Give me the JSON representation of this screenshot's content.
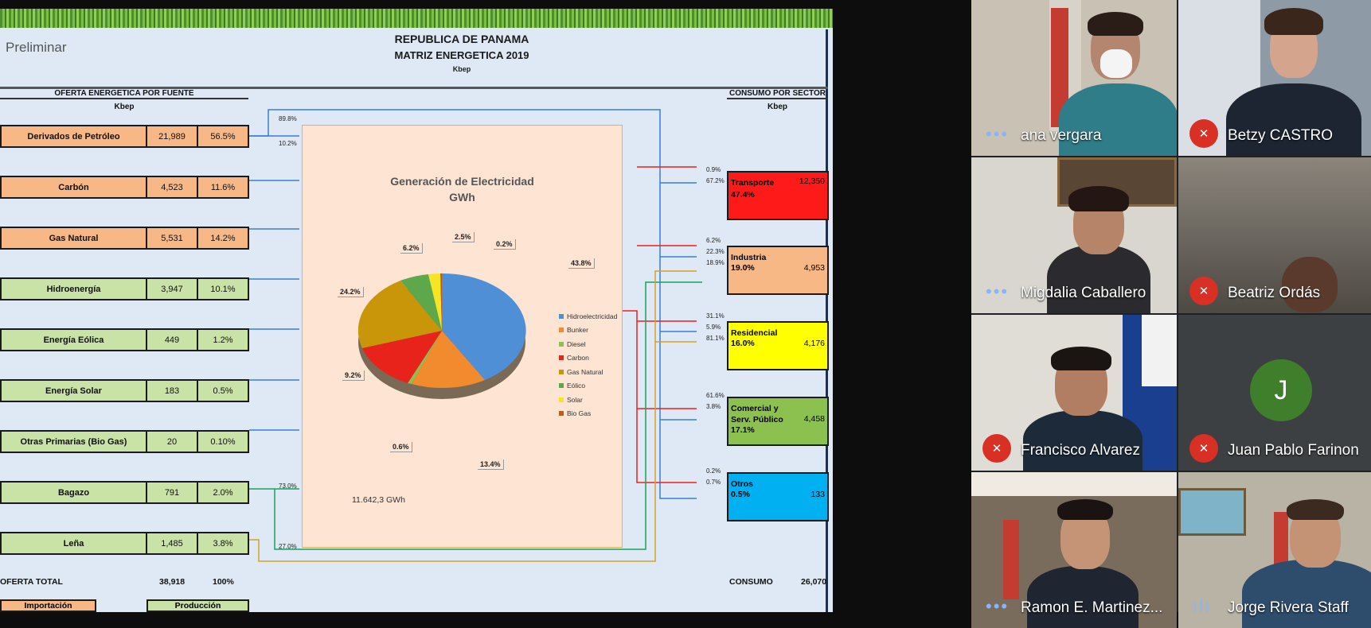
{
  "slide": {
    "status": "Preliminar",
    "title": "REPUBLICA DE PANAMA",
    "subtitle": "MATRIZ ENERGETICA  2019",
    "unit": "Kbep",
    "left_header": "OFERTA ENERGETICA POR FUENTE",
    "left_unit": "Kbep",
    "right_header": "CONSUMO POR SECTOR",
    "right_unit": "Kbep",
    "sources": [
      {
        "name": "Derivados de Petróleo",
        "value": "21,989",
        "pct": "56.5%",
        "group": "orange"
      },
      {
        "name": "Carbón",
        "value": "4,523",
        "pct": "11.6%",
        "group": "orange"
      },
      {
        "name": "Gas Natural",
        "value": "5,531",
        "pct": "14.2%",
        "group": "orange"
      },
      {
        "name": "Hidroenergía",
        "value": "3,947",
        "pct": "10.1%",
        "group": "green"
      },
      {
        "name": "Energía Eólica",
        "value": "449",
        "pct": "1.2%",
        "group": "green"
      },
      {
        "name": "Energía Solar",
        "value": "183",
        "pct": "0.5%",
        "group": "green"
      },
      {
        "name": "Otras Primarias (Bio Gas)",
        "value": "20",
        "pct": "0.10%",
        "group": "green"
      },
      {
        "name": "Bagazo",
        "value": "791",
        "pct": "2.0%",
        "group": "green"
      },
      {
        "name": "Leña",
        "value": "1,485",
        "pct": "3.8%",
        "group": "green"
      }
    ],
    "flow_labels": {
      "petroleo_top": "89.8%",
      "petroleo_bottom": "10.2%",
      "bagazo_top": "73.0%",
      "bagazo_bottom": "27.0%"
    },
    "generation": {
      "title": "Generación de Electricidad",
      "unit": "GWh",
      "total": "11.642,3  GWh",
      "labels": [
        "43.8%",
        "13.4%",
        "0.6%",
        "9.2%",
        "24.2%",
        "6.2%",
        "2.5%",
        "0.2%"
      ],
      "legend": [
        {
          "name": "Hidroelectricidad",
          "color": "#4f8fd6"
        },
        {
          "name": "Bunker",
          "color": "#f28a2e"
        },
        {
          "name": "Diesel",
          "color": "#8cc04f"
        },
        {
          "name": "Carbon",
          "color": "#e8231b"
        },
        {
          "name": "Gas Natural",
          "color": "#c9960a"
        },
        {
          "name": "Eólico",
          "color": "#5da84a"
        },
        {
          "name": "Solar",
          "color": "#f5e524"
        },
        {
          "name": "Bio Gas",
          "color": "#c45a1a"
        }
      ]
    },
    "sectors": [
      {
        "name": "Transporte",
        "value": "12,350",
        "pct": "47.4%",
        "color": "#ff1a1a",
        "in": [
          "0.9%",
          "67.2%"
        ]
      },
      {
        "name": "Industria",
        "value": "4,953",
        "pct": "19.0%",
        "color": "#f8b886",
        "in": [
          "6.2%",
          "22.3%",
          "18.9%"
        ]
      },
      {
        "name": "Residencial",
        "value": "4,176",
        "pct": "16.0%",
        "color": "#ffff00",
        "in": [
          "31.1%",
          "5.9%",
          "81.1%"
        ]
      },
      {
        "name": "Comercial y",
        "name2": "Serv. Público",
        "value": "4,458",
        "pct": "17.1%",
        "color": "#8cc04f",
        "in": [
          "61.6%",
          "3.8%"
        ]
      },
      {
        "name": "Otros",
        "value": "133",
        "pct": "0.5%",
        "color": "#00b0f0",
        "in": [
          "0.2%",
          "0.7%"
        ]
      }
    ],
    "oferta_total_label": "OFERTA  TOTAL",
    "oferta_total_value": "38,918",
    "oferta_total_pct": "100%",
    "consumo_label": "CONSUMO",
    "consumo_value": "26,070",
    "importacion": "Importación",
    "produccion": "Producción"
  },
  "participants": [
    {
      "name": "ana vergara",
      "state": "more"
    },
    {
      "name": "Betzy CASTRO",
      "state": "muted"
    },
    {
      "name": "Migdalia Caballero",
      "state": "more"
    },
    {
      "name": "Beatriz Ordás",
      "state": "muted"
    },
    {
      "name": "Francisco Alvarez",
      "state": "muted"
    },
    {
      "name": "Juan Pablo Farinon",
      "state": "muted",
      "initial": "J"
    },
    {
      "name": "Ramon E. Martinez...",
      "state": "more"
    },
    {
      "name": "Jorge Rivera Staff",
      "state": "speaking"
    }
  ]
}
